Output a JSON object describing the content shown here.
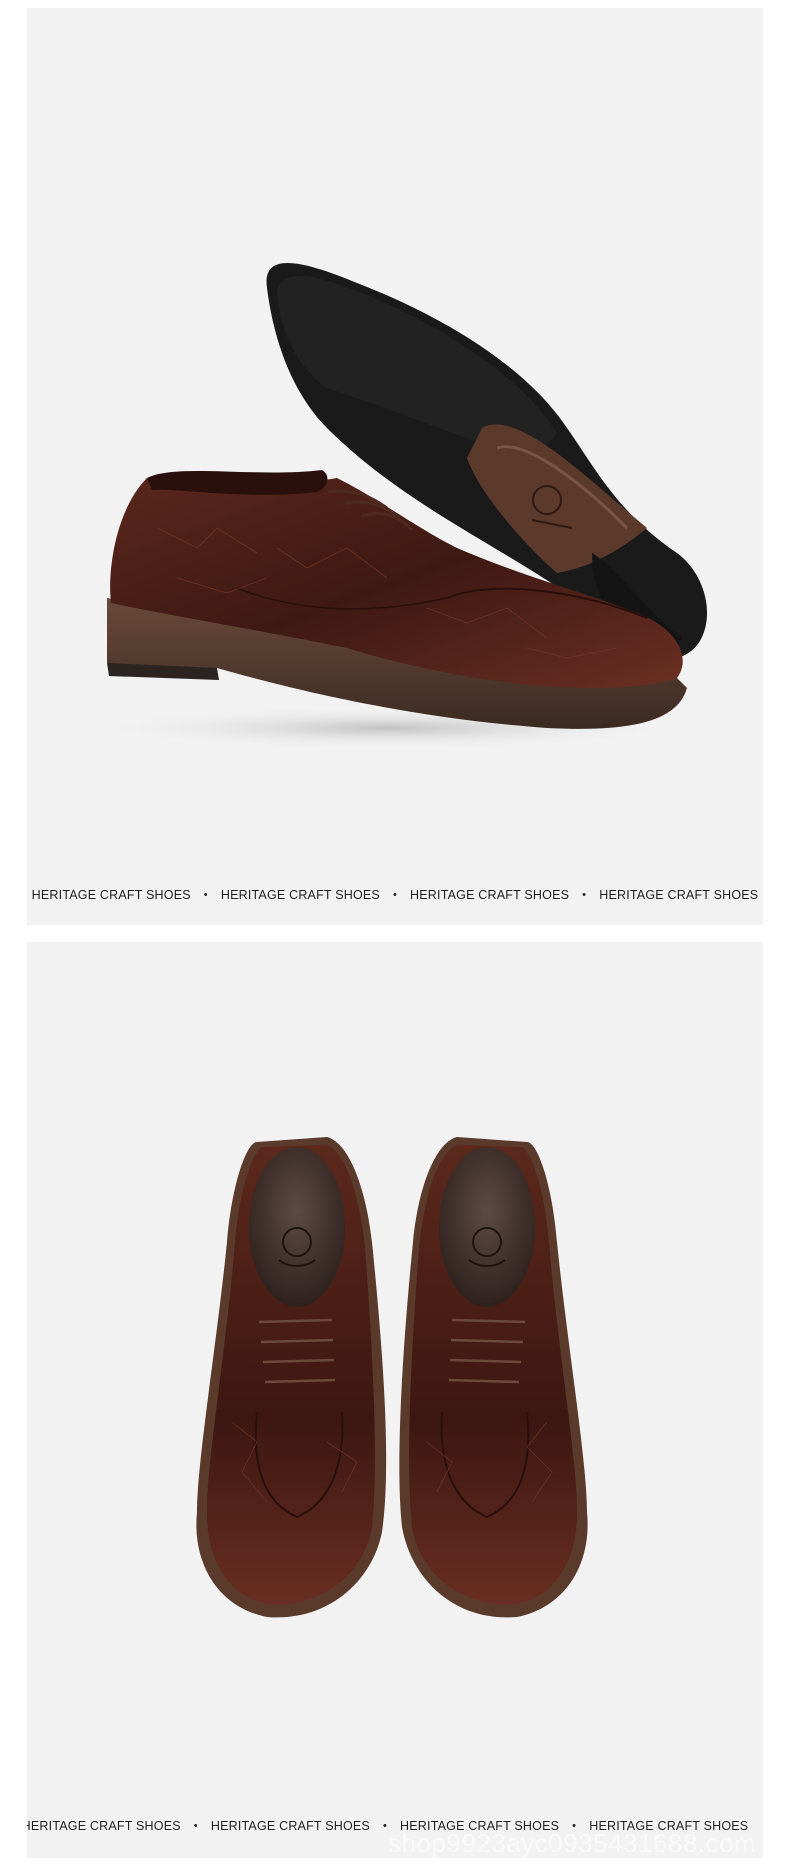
{
  "captions": {
    "top": [
      "HERITAGE CRAFT SHOES",
      "HERITAGE CRAFT SHOES",
      "HERITAGE CRAFT SHOES",
      "HERITAGE CRAFT SHOES"
    ],
    "bottom": [
      "HERITAGE CRAFT SHOES",
      "HERITAGE CRAFT SHOES",
      "HERITAGE CRAFT SHOES",
      "HERITAGE CRAFT SHOES"
    ]
  },
  "separator": "•",
  "watermark": "shop9923ayc0935431688.com",
  "colors": {
    "background": "#f2f2f2",
    "leather": "#4a1f17",
    "sole": "#1c1c1c",
    "text": "#1f1f1f"
  }
}
